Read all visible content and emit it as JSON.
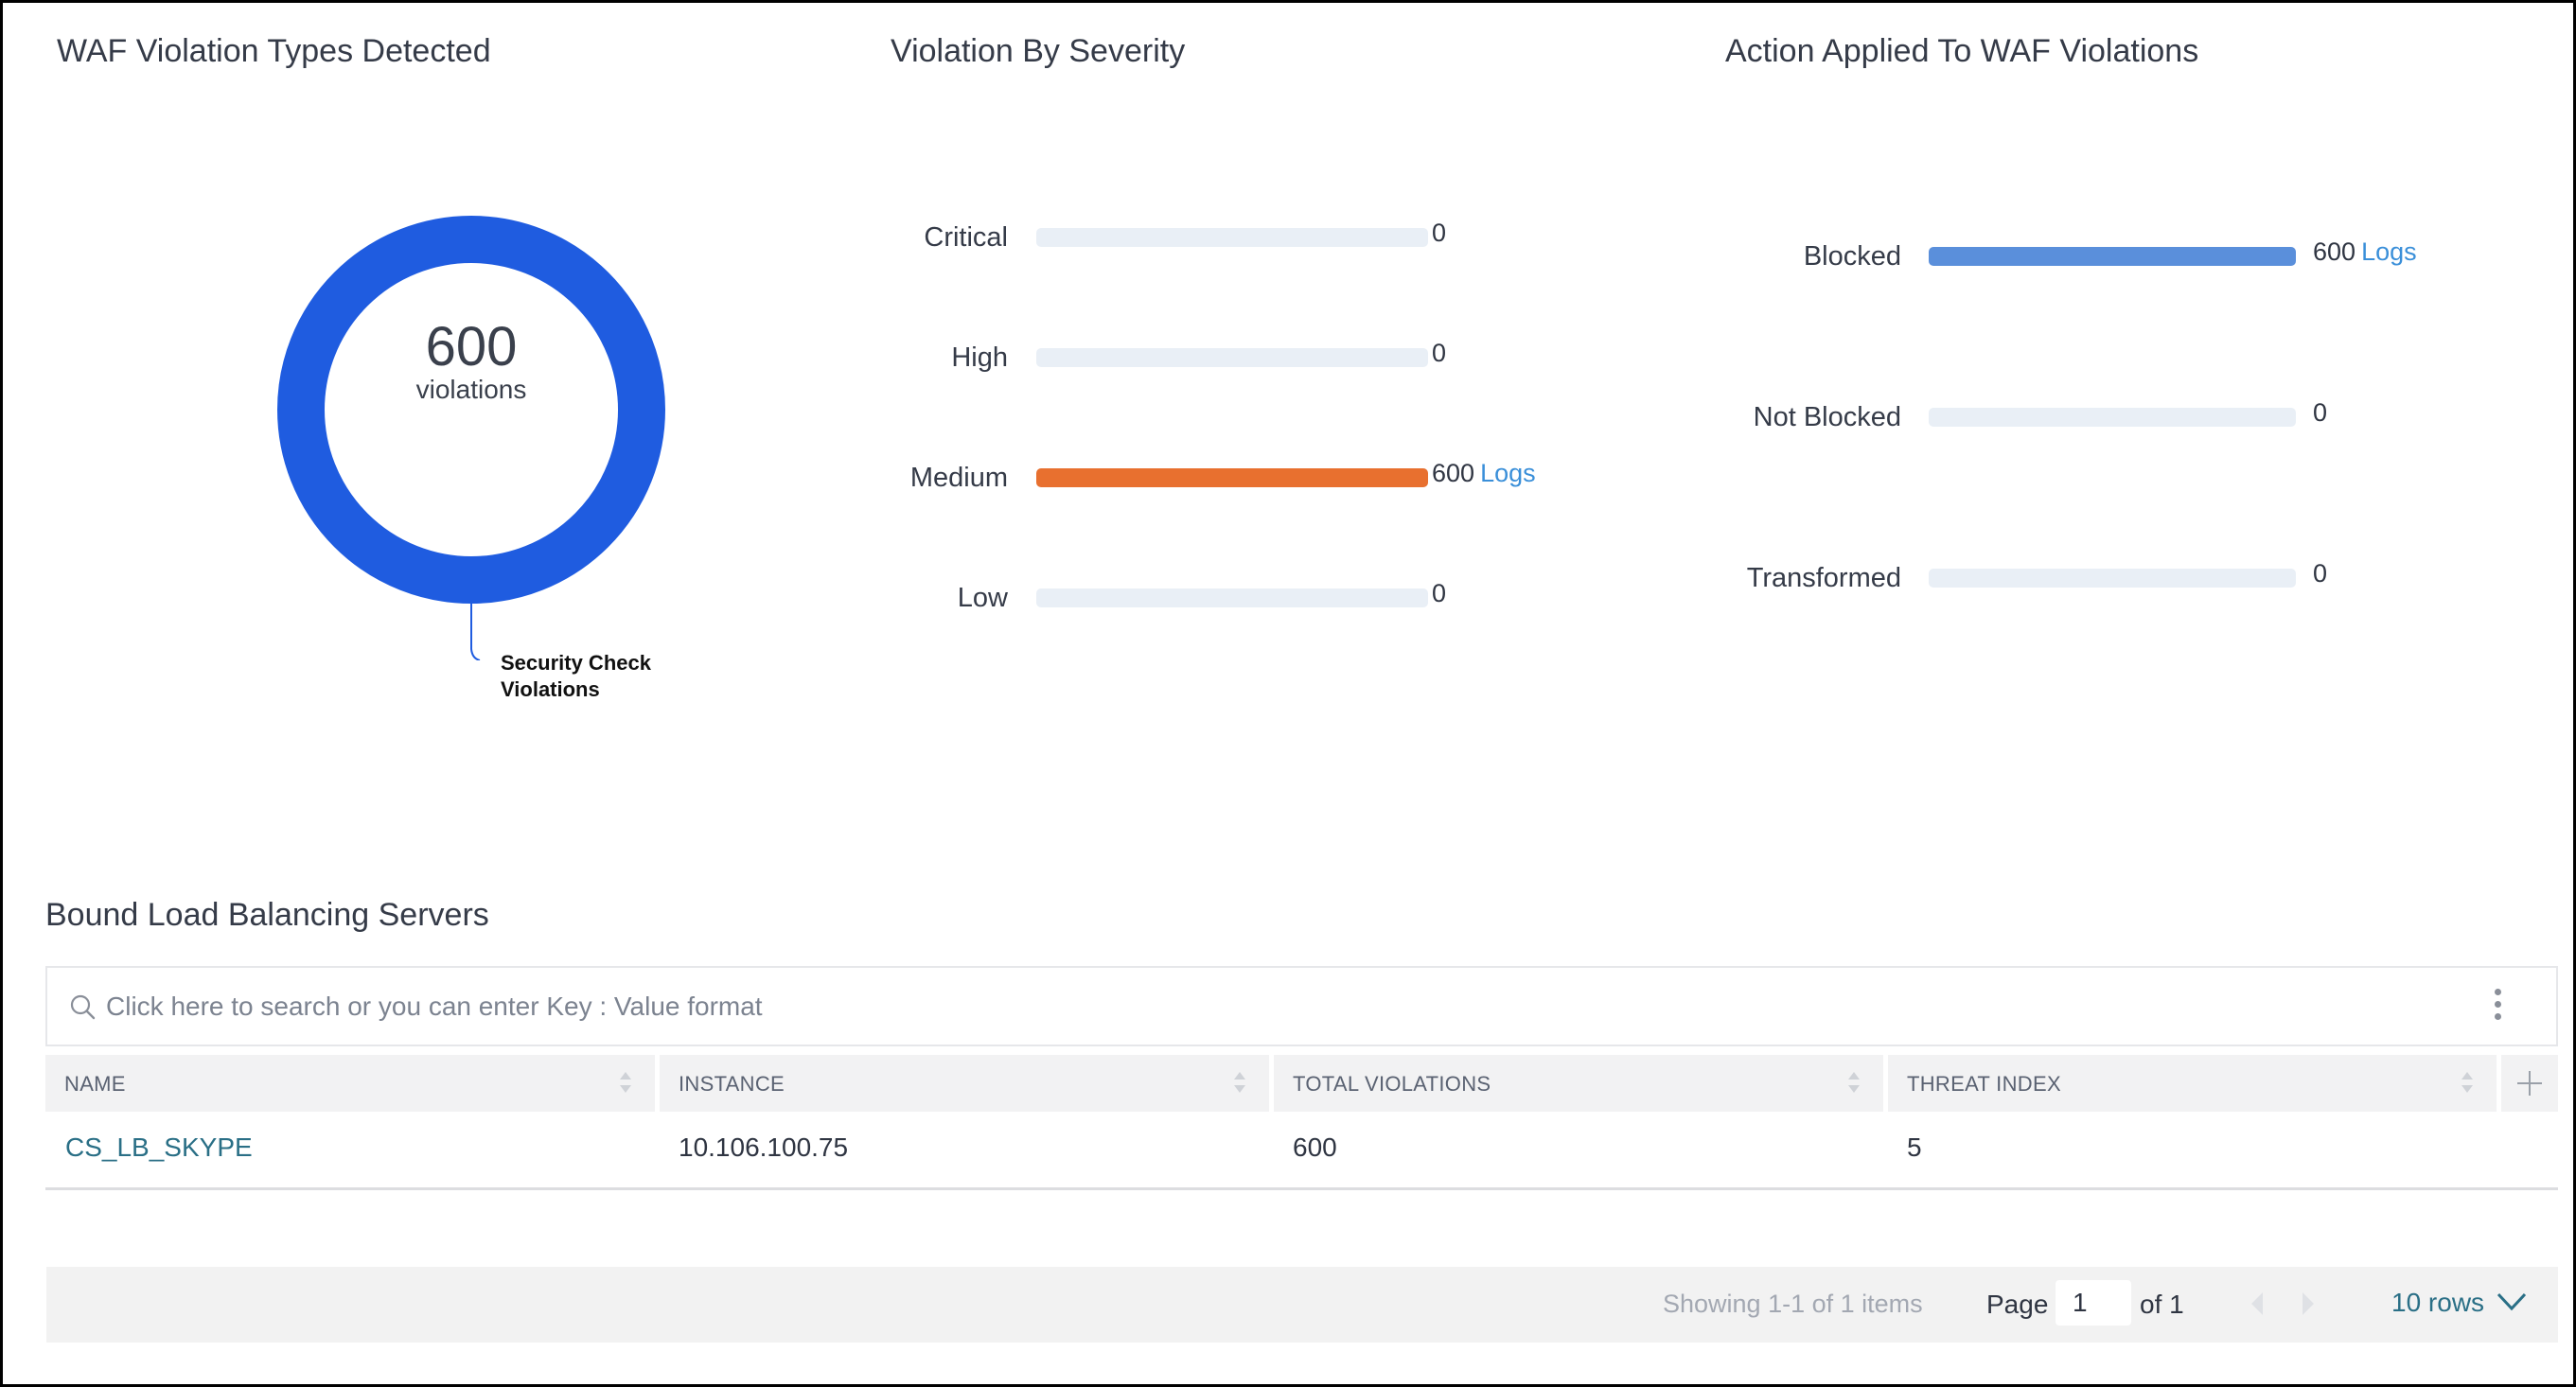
{
  "panels": {
    "types": {
      "title": "WAF Violation Types Detected",
      "center_value": "600",
      "center_label": "violations",
      "legend_label": "Security Check Violations",
      "color": "#1f5ce0"
    },
    "severity": {
      "title": "Violation By Severity",
      "logs_label": "Logs",
      "rows": [
        {
          "label": "Critical",
          "value": "0"
        },
        {
          "label": "High",
          "value": "0"
        },
        {
          "label": "Medium",
          "value": "600"
        },
        {
          "label": "Low",
          "value": "0"
        }
      ]
    },
    "action": {
      "title": "Action Applied To WAF Violations",
      "logs_label": "Logs",
      "rows": [
        {
          "label": "Blocked",
          "value": "600"
        },
        {
          "label": "Not Blocked",
          "value": "0"
        },
        {
          "label": "Transformed",
          "value": "0"
        }
      ]
    }
  },
  "chart_data": [
    {
      "type": "pie",
      "title": "WAF Violation Types Detected",
      "labels": [
        "Security Check Violations"
      ],
      "values": [
        600
      ],
      "total": 600,
      "center_text": "600 violations",
      "colors": [
        "#1f5ce0"
      ]
    },
    {
      "type": "bar",
      "orientation": "horizontal",
      "title": "Violation By Severity",
      "categories": [
        "Critical",
        "High",
        "Medium",
        "Low"
      ],
      "values": [
        0,
        0,
        600,
        0
      ],
      "xlim": [
        0,
        600
      ],
      "colors": {
        "Critical": "#e9eff6",
        "High": "#e9eff6",
        "Medium": "#e8702f",
        "Low": "#e9eff6"
      },
      "track_color": "#e9eff6",
      "data_label_suffix": "Logs"
    },
    {
      "type": "bar",
      "orientation": "horizontal",
      "title": "Action Applied To WAF Violations",
      "categories": [
        "Blocked",
        "Not Blocked",
        "Transformed"
      ],
      "values": [
        600,
        0,
        0
      ],
      "xlim": [
        0,
        600
      ],
      "colors": {
        "Blocked": "#5a8fdb",
        "Not Blocked": "#e9eff6",
        "Transformed": "#e9eff6"
      },
      "track_color": "#e9eff6",
      "data_label_suffix": "Logs"
    }
  ],
  "table": {
    "title": "Bound Load Balancing Servers",
    "search_placeholder": "Click here to search or you can enter Key : Value format",
    "columns": [
      "NAME",
      "INSTANCE",
      "TOTAL VIOLATIONS",
      "THREAT INDEX"
    ],
    "rows": [
      {
        "name": "CS_LB_SKYPE",
        "instance": "10.106.100.75",
        "total_violations": "600",
        "threat_index": "5"
      }
    ],
    "footer": {
      "showing": "Showing 1-1 of 1 items",
      "page_label": "Page",
      "page_value": "1",
      "of_label": "of 1",
      "rows_label": "10 rows"
    }
  },
  "colors": {
    "link": "#2a6f86",
    "logs_link": "#3a8fd9",
    "medium": "#e8702f",
    "blocked": "#5a8fdb",
    "donut": "#1f5ce0"
  }
}
